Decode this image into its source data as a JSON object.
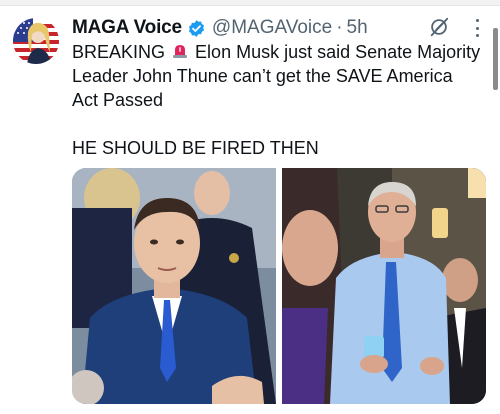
{
  "post": {
    "author": {
      "display_name": "MAGA Voice",
      "handle": "@MAGAVoice",
      "separator": "·",
      "time": "5h",
      "verified": true,
      "avatar_icon": "profile-avatar-flag-portrait",
      "verified_icon": "verified-check-icon"
    },
    "text": {
      "line1_prefix": "BREAKING",
      "emoji": "police-light-icon",
      "line1_suffix": " Elon Musk just said Senate Majority Leader John Thune can’t get the SAVE America Act Passed",
      "line2": "HE SHOULD BE FIRED THEN"
    },
    "media": [
      {
        "alt_icon": "photo-elon-musk",
        "description_icon": "photo"
      },
      {
        "alt_icon": "photo-john-thune",
        "description_icon": "photo"
      }
    ],
    "actions": {
      "grok_icon": "grok-icon",
      "more_icon": "more-options-icon"
    }
  },
  "colors": {
    "verified_blue": "#1d9bf0",
    "secondary_text": "#536471",
    "primary_text": "#0f1419"
  }
}
